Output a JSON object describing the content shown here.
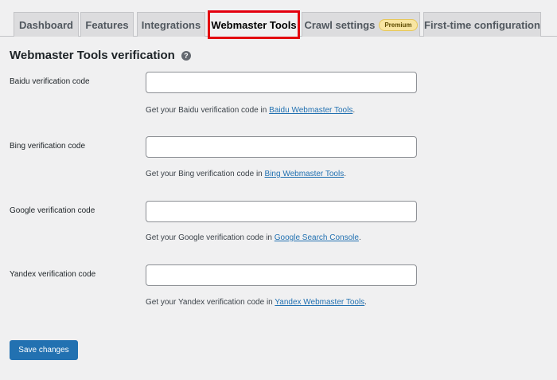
{
  "tabs": [
    {
      "label": "Dashboard"
    },
    {
      "label": "Features"
    },
    {
      "label": "Integrations"
    },
    {
      "label": "Webmaster Tools"
    },
    {
      "label": "Crawl settings",
      "badge": "Premium"
    },
    {
      "label": "First-time configuration"
    }
  ],
  "active_tab": "Webmaster Tools",
  "section": {
    "title": "Webmaster Tools verification",
    "help_icon": "question-circle-icon"
  },
  "fields": [
    {
      "label": "Baidu verification code",
      "value": "",
      "desc_prefix": "Get your Baidu verification code in ",
      "link": "Baidu Webmaster Tools",
      "desc_suffix": "."
    },
    {
      "label": "Bing verification code",
      "value": "",
      "desc_prefix": "Get your Bing verification code in ",
      "link": "Bing Webmaster Tools",
      "desc_suffix": "."
    },
    {
      "label": "Google verification code",
      "value": "",
      "desc_prefix": "Get your Google verification code in ",
      "link": "Google Search Console",
      "desc_suffix": "."
    },
    {
      "label": "Yandex verification code",
      "value": "",
      "desc_prefix": "Get your Yandex verification code in ",
      "link": "Yandex Webmaster Tools",
      "desc_suffix": "."
    }
  ],
  "save_label": "Save changes",
  "colors": {
    "primary": "#2271b1",
    "highlight": "#e3000f",
    "background": "#f0f0f1"
  }
}
